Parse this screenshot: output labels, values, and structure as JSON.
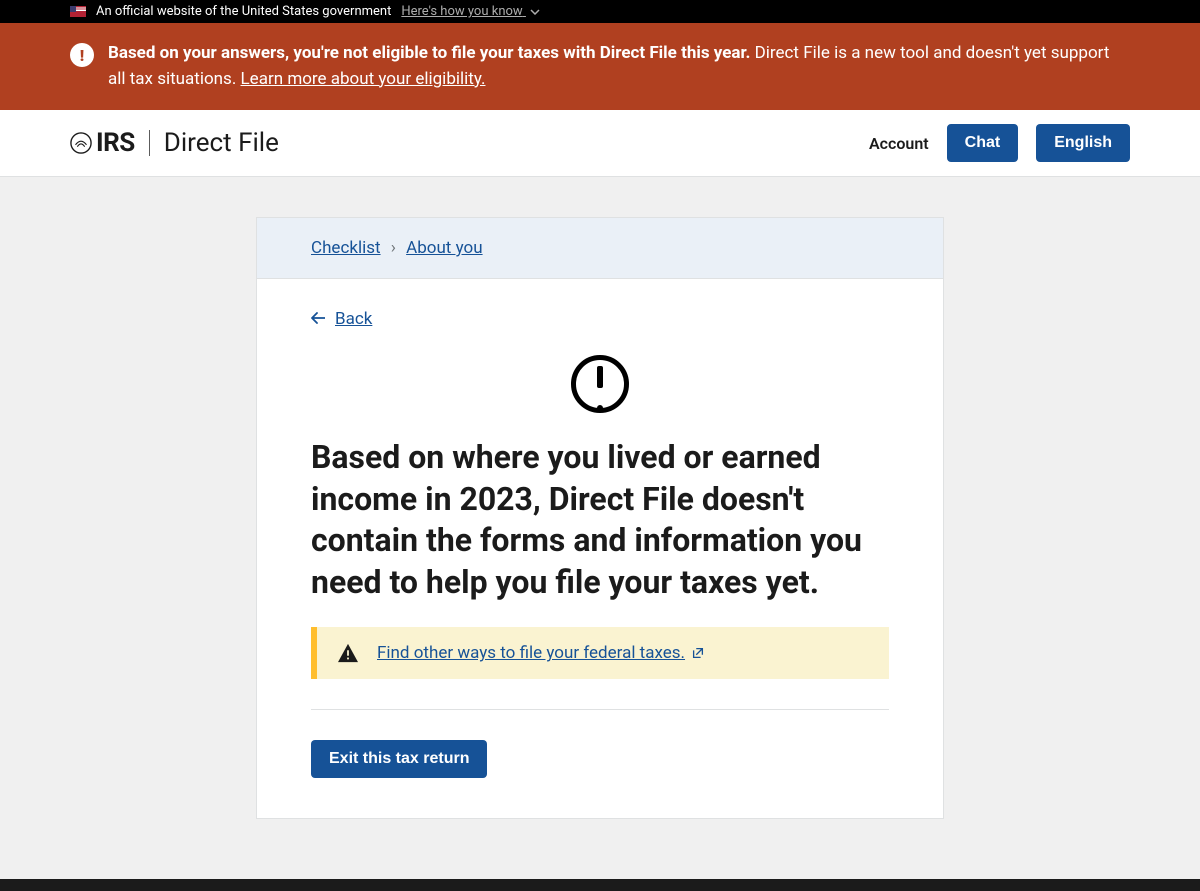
{
  "gov_banner": {
    "text": "An official website of the United States government",
    "link": "Here's how you know"
  },
  "alert": {
    "bold": "Based on your answers, you're not eligible to file your taxes with Direct File this year.",
    "rest": " Direct File is a new tool and doesn't yet support all tax situations. ",
    "link": "Learn more about your eligibility."
  },
  "header": {
    "irs": "IRS",
    "product": "Direct File",
    "account": "Account",
    "chat": "Chat",
    "language": "English"
  },
  "breadcrumb": {
    "item1": "Checklist",
    "item2": "About you"
  },
  "content": {
    "back": "Back",
    "headline": "Based on where you lived or earned income in 2023, Direct File doesn't contain the forms and information you need to help you file your taxes yet.",
    "warning_link": "Find other ways to file your federal taxes.",
    "exit_button": "Exit this tax return"
  }
}
